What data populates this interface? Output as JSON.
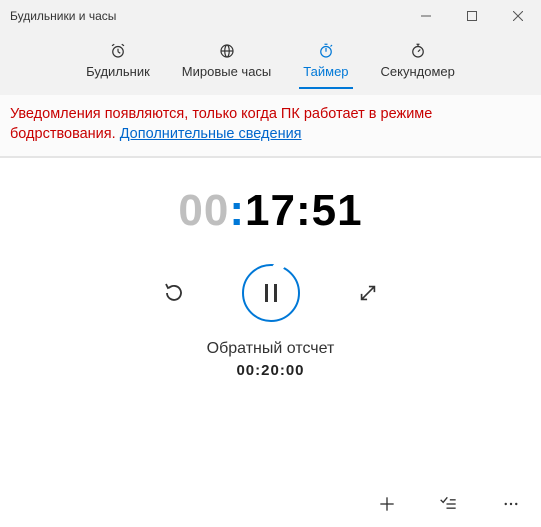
{
  "window": {
    "title": "Будильники и часы"
  },
  "tabs": {
    "alarm": "Будильник",
    "worldclock": "Мировые часы",
    "timer": "Таймер",
    "stopwatch": "Секундомер"
  },
  "notice": {
    "text": "Уведомления появляются, только когда ПК работает в режиме бодрствования. ",
    "link": "Дополнительные сведения"
  },
  "timer": {
    "hh": "00",
    "mm": "17",
    "ss": "51",
    "label": "Обратный отсчет",
    "total": "00:20:00"
  }
}
